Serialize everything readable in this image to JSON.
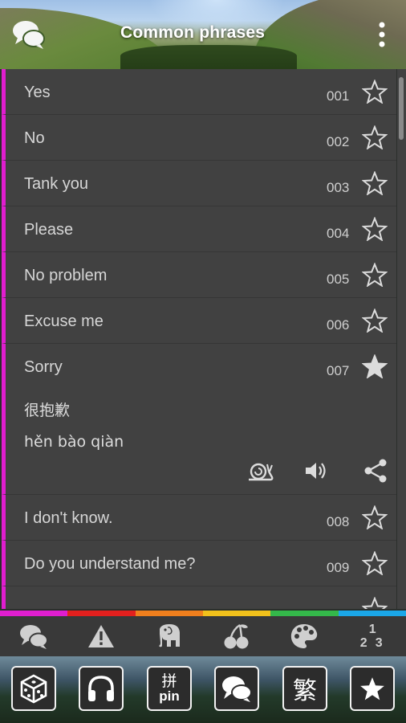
{
  "header": {
    "title": "Common phrases"
  },
  "phrases": [
    {
      "text": "Yes",
      "num": "001",
      "starred": false
    },
    {
      "text": "No",
      "num": "002",
      "starred": false
    },
    {
      "text": "Tank you",
      "num": "003",
      "starred": false
    },
    {
      "text": "Please",
      "num": "004",
      "starred": false
    },
    {
      "text": "No problem",
      "num": "005",
      "starred": false
    },
    {
      "text": "Excuse me",
      "num": "006",
      "starred": false
    },
    {
      "text": "Sorry",
      "num": "007",
      "starred": true,
      "hanzi": "很抱歉",
      "pinyin": "hěn bào qiàn"
    },
    {
      "text": "I don't know.",
      "num": "008",
      "starred": false
    },
    {
      "text": "Do you understand me?",
      "num": "009",
      "starred": false
    }
  ],
  "strip_colors": [
    "#e01ecf",
    "#e3201e",
    "#f07f1d",
    "#f2c11b",
    "#34b84a",
    "#1ba7e8"
  ],
  "categories": [
    "chat-icon",
    "warning-icon",
    "elephant-icon",
    "cherries-icon",
    "palette-icon",
    "numbers-icon"
  ],
  "numbers_glyphs": {
    "top": "1",
    "left": "2",
    "right": "3"
  },
  "toolbar": {
    "buttons": [
      "dice-icon",
      "headphones-icon",
      "pinyin-icon",
      "chat-icon",
      "traditional-icon",
      "star-icon"
    ],
    "pinyin_top": "拼",
    "pinyin_bottom": "pin",
    "traditional": "繁"
  }
}
